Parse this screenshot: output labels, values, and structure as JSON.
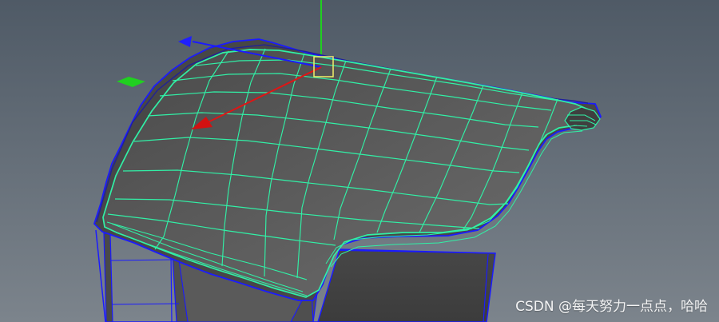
{
  "watermark": {
    "text": "CSDN @每天努力一点点，哈哈"
  },
  "colors": {
    "viewport_top": "#4f5a66",
    "viewport_bottom": "#7c848c",
    "wire": "#31f0a6",
    "wire_dim": "#28d48f",
    "blue_edge": "#1b1bff",
    "red_axis": "#e01515",
    "green_axis": "#20d020",
    "selection_box": "#f1f06a",
    "surface_dark": "#3f3f3f",
    "surface_mid": "#575757",
    "surface_light": "#727272",
    "underside": "#4b4b4b"
  },
  "icons": {
    "move_manipulator": "move-manipulator-icon",
    "pivot": "pivot-icon",
    "y_axis": "y-axis-icon",
    "x_axis_arrow": "x-axis-arrow-icon",
    "z_axis_arrow": "z-axis-arrow-icon",
    "plane_handle": "plane-handle-icon"
  }
}
